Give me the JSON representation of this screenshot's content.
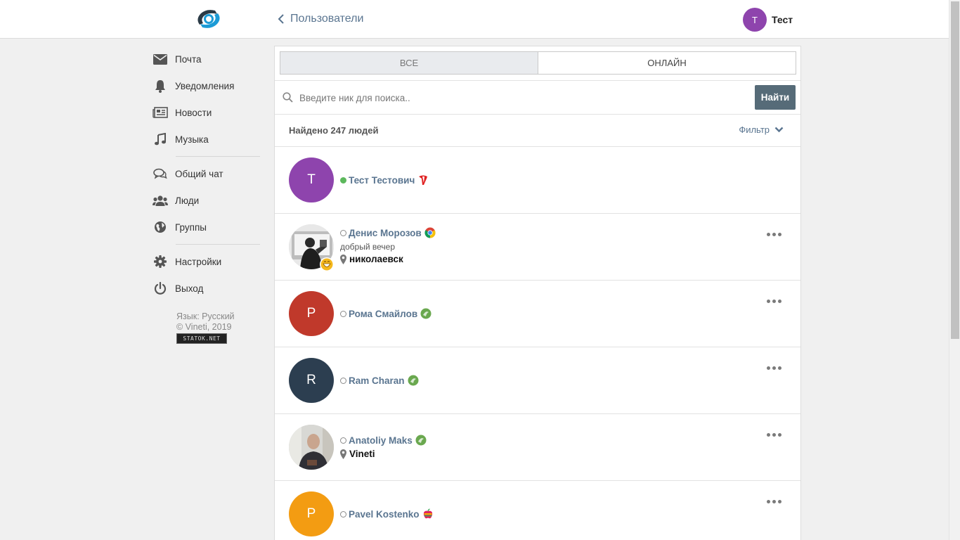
{
  "header": {
    "back_label": "Пользователи",
    "user_initial": "Т",
    "user_name": "Тест"
  },
  "sidebar": {
    "items": [
      {
        "label": "Почта",
        "icon": "mail-icon"
      },
      {
        "label": "Уведомления",
        "icon": "bell-icon"
      },
      {
        "label": "Новости",
        "icon": "newspaper-icon"
      },
      {
        "label": "Музыка",
        "icon": "music-icon"
      },
      {
        "label": "Общий чат",
        "icon": "chat-icon"
      },
      {
        "label": "Люди",
        "icon": "users-icon"
      },
      {
        "label": "Группы",
        "icon": "globe-icon"
      },
      {
        "label": "Настройки",
        "icon": "gear-icon"
      },
      {
        "label": "Выход",
        "icon": "power-icon"
      }
    ],
    "language": "Язык: Русский",
    "copyright": "© Vineti, 2019",
    "counter_label": "STATOK.NET"
  },
  "tabs": {
    "all": "ВСЕ",
    "online": "ОНЛАЙН",
    "active": "all"
  },
  "search": {
    "placeholder": "Введите ник для поиска..",
    "value": "",
    "button_label": "Найти"
  },
  "results": {
    "count_label": "Найдено 247 людей",
    "filter_label": "Фильтр"
  },
  "users": [
    {
      "name": "Тест Тестович",
      "initial": "Т",
      "avatar_color": "#8e44ad",
      "online": true,
      "browser_icon": "yandex-browser-icon",
      "status_text": "",
      "location": "",
      "has_menu": false
    },
    {
      "name": "Денис Морозов",
      "initial": "",
      "avatar_color": "#cccccc",
      "online": false,
      "browser_icon": "chrome-icon",
      "status_text": "добрый вечер",
      "location": "николаевск",
      "has_menu": true,
      "photo": "photo-bw",
      "emoji_badge": "grin-emoji-icon"
    },
    {
      "name": "Рома Смайлов",
      "initial": "Р",
      "avatar_color": "#c0392b",
      "online": false,
      "browser_icon": "android-icon",
      "status_text": "",
      "location": "",
      "has_menu": true
    },
    {
      "name": "Ram Charan",
      "initial": "R",
      "avatar_color": "#2c3e50",
      "online": false,
      "browser_icon": "android-icon",
      "status_text": "",
      "location": "",
      "has_menu": true
    },
    {
      "name": "Anatoliy Maks",
      "initial": "",
      "avatar_color": "#cccccc",
      "online": false,
      "browser_icon": "android-icon",
      "status_text": "",
      "location": "Vineti",
      "has_menu": true,
      "photo": "photo-man"
    },
    {
      "name": "Pavel Kostenko",
      "initial": "P",
      "avatar_color": "#f39c12",
      "online": false,
      "browser_icon": "apple-icon",
      "status_text": "",
      "location": "",
      "has_menu": true
    }
  ],
  "colors": {
    "link": "#5a7590",
    "button": "#566b78",
    "online": "#5cb85c"
  }
}
